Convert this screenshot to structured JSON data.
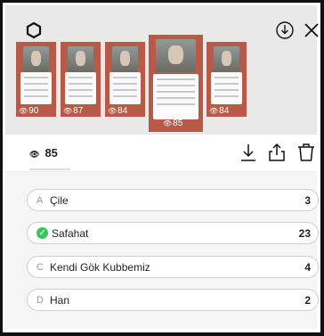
{
  "header": {
    "left_icon": "hexagon-icon",
    "right_icons": [
      "save-download-icon",
      "close-icon"
    ]
  },
  "stories": [
    {
      "views": "90"
    },
    {
      "views": "87"
    },
    {
      "views": "84"
    },
    {
      "views": "85",
      "active": true
    },
    {
      "views": "84"
    }
  ],
  "stats": {
    "views": "85",
    "icons": [
      "download-icon",
      "share-icon",
      "delete-icon"
    ]
  },
  "poll": {
    "options": [
      {
        "letter": "A",
        "label": "Çile",
        "count": "3",
        "correct": false
      },
      {
        "letter": "",
        "label": "Safahat",
        "count": "23",
        "correct": true
      },
      {
        "letter": "C",
        "label": "Kendi Gök Kubbemiz",
        "count": "4",
        "correct": false
      },
      {
        "letter": "D",
        "label": "Han",
        "count": "2",
        "correct": false
      }
    ]
  },
  "colors": {
    "story_bg": "#b85a47",
    "correct": "#34c759"
  }
}
